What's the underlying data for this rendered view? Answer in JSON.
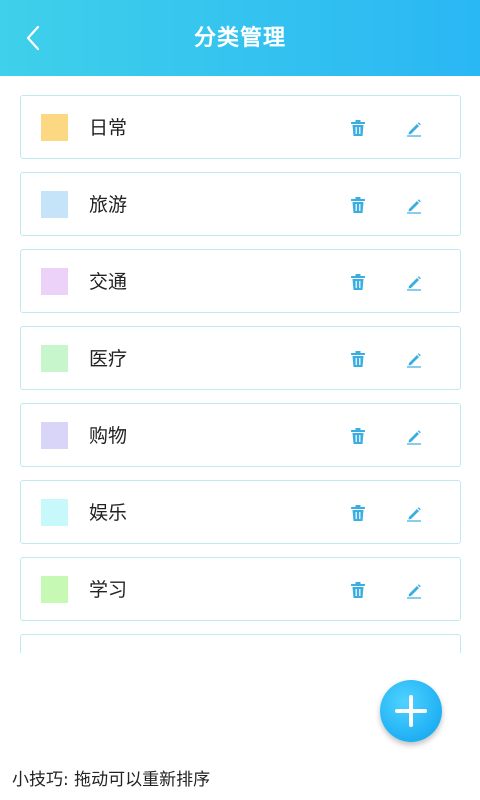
{
  "header": {
    "title": "分类管理",
    "back_icon": "chevron-left-icon"
  },
  "categories": [
    {
      "name": "日常",
      "color": "#fdd882"
    },
    {
      "name": "旅游",
      "color": "#c5e4fa"
    },
    {
      "name": "交通",
      "color": "#ecd2f9"
    },
    {
      "name": "医疗",
      "color": "#c7f6cc"
    },
    {
      "name": "购物",
      "color": "#d8d5f8"
    },
    {
      "name": "娱乐",
      "color": "#c7f9fb"
    },
    {
      "name": "学习",
      "color": "#c6f9b3"
    },
    {
      "name": "",
      "color": ""
    }
  ],
  "item_icons": {
    "delete": "trash-icon",
    "edit": "pencil-icon"
  },
  "add_button": {
    "icon": "plus-icon"
  },
  "tip": "小技巧: 拖动可以重新排序",
  "colors": {
    "header_start": "#3fd0ea",
    "header_end": "#2ab7f4",
    "item_border": "#bfe9f2",
    "icon_accent": "#3aaee0",
    "fab": "#1fb0f4"
  }
}
